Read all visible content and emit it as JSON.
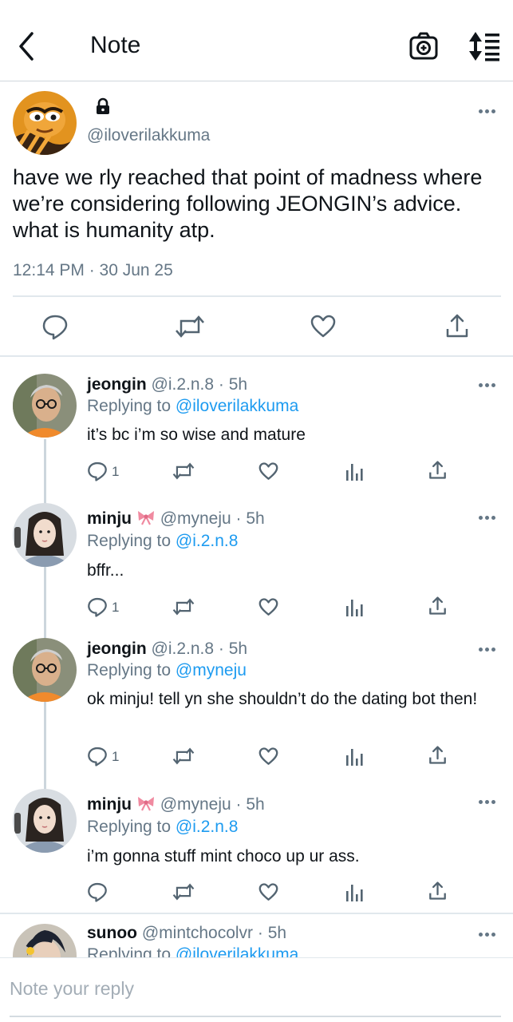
{
  "header": {
    "title": "Note",
    "back_icon": "chevron-left-icon",
    "camera_icon": "camera-icon",
    "sort_icon": "sort-icon"
  },
  "main_post": {
    "handle": "@iloverilakkuma",
    "text": "have we rly reached that point of madness where we’re considering following JEONGIN’s advice. what is humanity atp.",
    "timestamp": "12:14 PM · 30 Jun 25",
    "icons": [
      "reply-icon",
      "retweet-icon",
      "like-icon",
      "share-icon"
    ]
  },
  "replies": [
    {
      "name": "jeongin",
      "handle": "@i.2.n.8",
      "time": "· 5h",
      "replying_prefix": "Replying to ",
      "replying_to": "@iloverilakkuma",
      "text": "it’s bc i’m so wise and mature",
      "reply_count": "1"
    },
    {
      "name": "minju",
      "handle": "@myneju",
      "time": "· 5h",
      "replying_prefix": "Replying to ",
      "replying_to": "@i.2.n.8",
      "text": "bffr...",
      "reply_count": "1"
    },
    {
      "name": "jeongin",
      "handle": "@i.2.n.8",
      "time": "· 5h",
      "replying_prefix": "Replying to ",
      "replying_to": "@myneju",
      "text": "ok minju! tell yn she shouldn’t do the dating bot then!",
      "reply_count": "1"
    },
    {
      "name": "minju",
      "handle": "@myneju",
      "time": "· 5h",
      "replying_prefix": "Replying to ",
      "replying_to": "@i.2.n.8",
      "text": "i’m gonna stuff mint choco up ur ass.",
      "reply_count": ""
    },
    {
      "name": "sunoo",
      "handle": "@mintchocolvr",
      "time": "· 5h",
      "replying_prefix": "Replying to ",
      "replying_to": "@iloverilakkuma",
      "text": "",
      "reply_count": ""
    }
  ],
  "reply_bar": {
    "placeholder": "Note your reply"
  },
  "colors": {
    "accent": "#1d9bf0",
    "text": "#0f1419",
    "secondary": "#657786",
    "divider": "#e1e8ed",
    "bow": "#f08aa0"
  }
}
